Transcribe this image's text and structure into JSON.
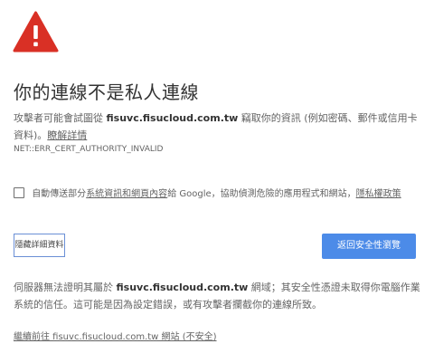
{
  "icon": {
    "name": "warning-triangle-icon",
    "color": "#d93025"
  },
  "title": "你的連線不是私人連線",
  "description": {
    "prefix": "攻擊者可能會試圖從 ",
    "domain": "fisuvc.fisucloud.com.tw",
    "suffix": " 竊取你的資訊 (例如密碼、郵件或信用卡資料)。",
    "details_link": "瞭解詳情"
  },
  "error_code": "NET::ERR_CERT_AUTHORITY_INVALID",
  "checkbox": {
    "checked": false,
    "prefix": "自動傳送部分",
    "link1": "系統資訊和網頁內容",
    "middle": "給 Google，協助偵測危險的應用程式和網站，",
    "link2": "隱私權政策"
  },
  "buttons": {
    "details": "隱藏詳細資料",
    "back": "返回安全性瀏覽"
  },
  "explanation": {
    "prefix": "伺服器無法證明其屬於 ",
    "domain": "fisuvc.fisucloud.com.tw",
    "suffix": " 網域；其安全性憑證未取得你電腦作業系統的信任。這可能是因為設定錯誤，或有攻擊者攔截你的連線所致。"
  },
  "proceed_link": "繼續前往 fisuvc.fisucloud.com.tw 網站 (不安全)",
  "colors": {
    "accent": "#4c8be8",
    "warning": "#d93025"
  }
}
